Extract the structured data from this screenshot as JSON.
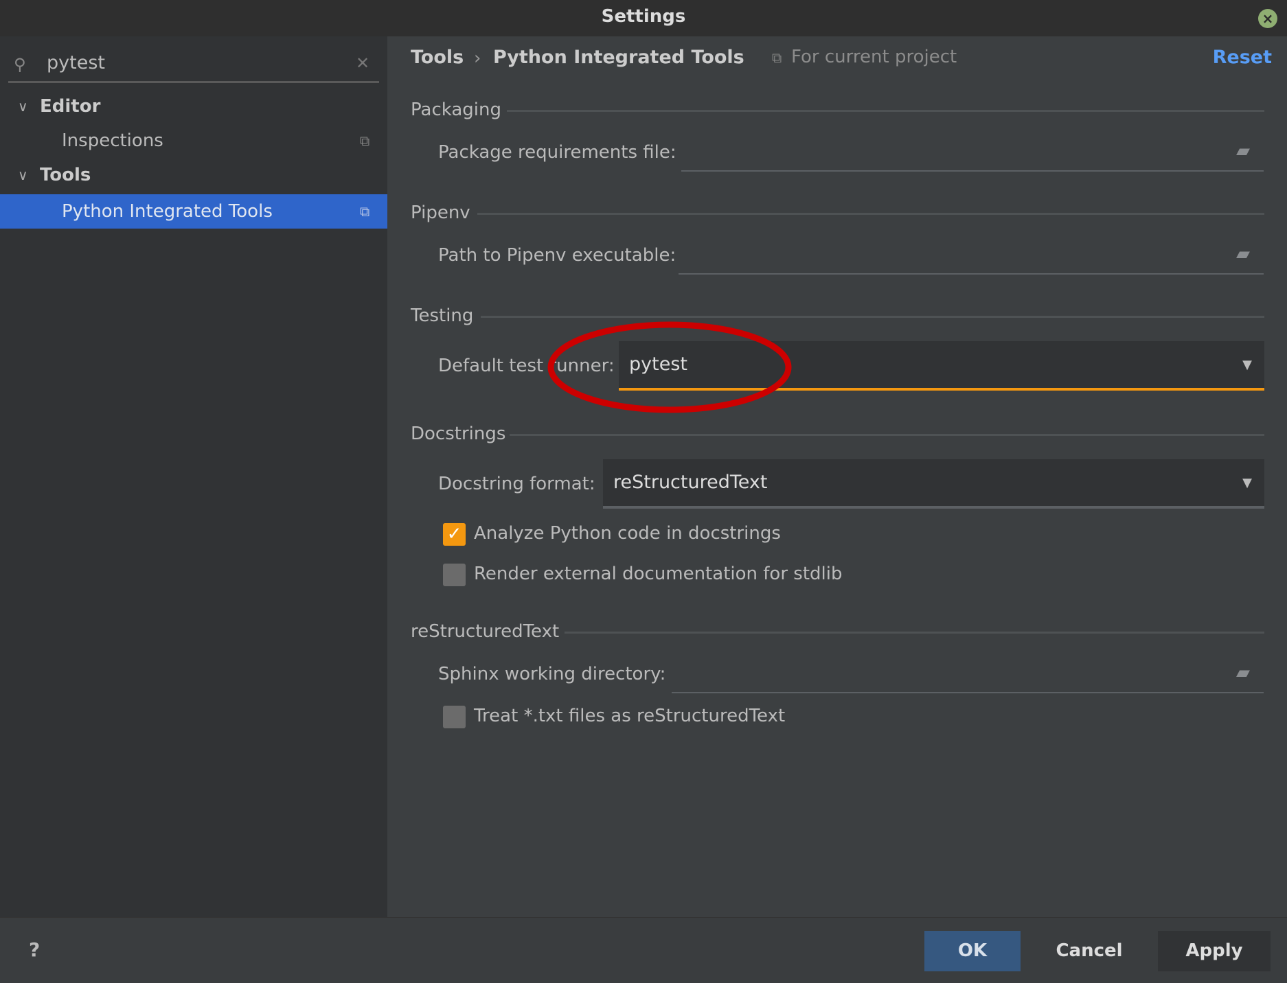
{
  "window": {
    "title": "Settings"
  },
  "sidebar": {
    "search_value": "pytest",
    "tree": [
      {
        "label": "Editor",
        "type": "group"
      },
      {
        "label": "Inspections",
        "type": "item"
      },
      {
        "label": "Tools",
        "type": "group"
      },
      {
        "label": "Python Integrated Tools",
        "type": "item",
        "selected": true
      }
    ]
  },
  "header": {
    "breadcrumb": [
      "Tools",
      "Python Integrated Tools"
    ],
    "separator": "›",
    "scope": "For current project",
    "reset": "Reset"
  },
  "sections": {
    "packaging": {
      "title": "Packaging",
      "req_label": "Package requirements file:",
      "req_value": ""
    },
    "pipenv": {
      "title": "Pipenv",
      "path_label": "Path to Pipenv executable:",
      "path_value": ""
    },
    "testing": {
      "title": "Testing",
      "runner_label": "Default test runner:",
      "runner_value": "pytest"
    },
    "docstrings": {
      "title": "Docstrings",
      "format_label": "Docstring format:",
      "format_value": "reStructuredText",
      "analyze_label": "Analyze Python code in docstrings",
      "analyze_checked": true,
      "render_label": "Render external documentation for stdlib",
      "render_checked": false
    },
    "rst": {
      "title": "reStructuredText",
      "sphinx_label": "Sphinx working directory:",
      "sphinx_value": "",
      "treat_label": "Treat *.txt files as reStructuredText",
      "treat_checked": false
    }
  },
  "footer": {
    "help": "?",
    "ok": "OK",
    "cancel": "Cancel",
    "apply": "Apply"
  },
  "colors": {
    "accent_blue": "#2f65ca",
    "focus_orange": "#f49810",
    "annotation_red": "#cc0000",
    "link": "#589df6"
  }
}
